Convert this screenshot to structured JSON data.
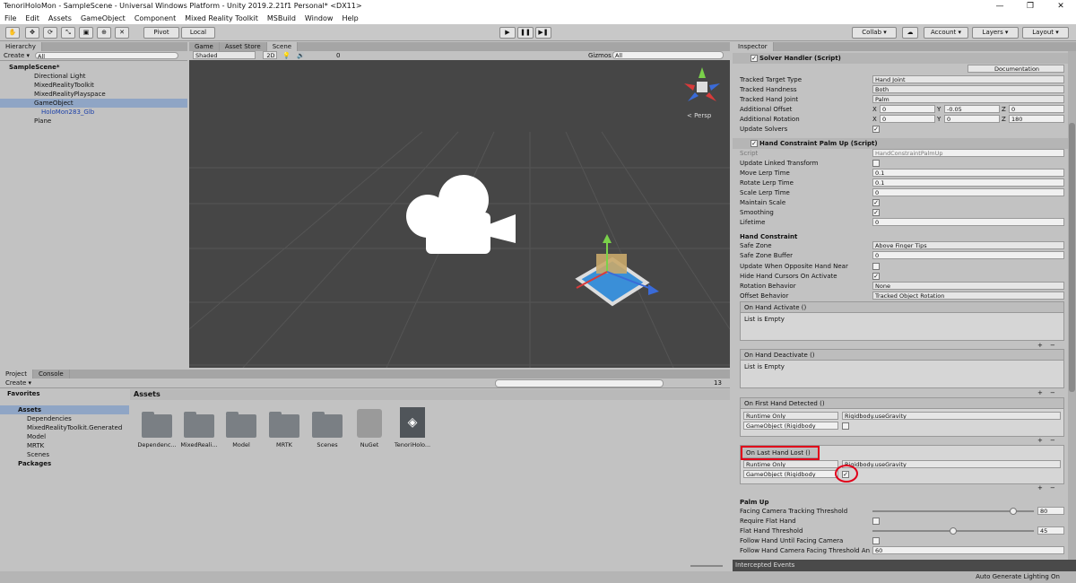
{
  "window": {
    "title": "TenoriHoloMon - SampleScene - Universal Windows Platform - Unity 2019.2.21f1 Personal* <DX11>",
    "min": "—",
    "max": "❐",
    "close": "✕"
  },
  "menu": [
    "File",
    "Edit",
    "Assets",
    "GameObject",
    "Component",
    "Mixed Reality Toolkit",
    "MSBuild",
    "Window",
    "Help"
  ],
  "toolbar": {
    "pivot": "Pivot",
    "local": "Local",
    "collab": "Collab ▾",
    "account": "Account ▾",
    "layers": "Layers ▾",
    "layout": "Layout ▾",
    "tools": [
      "✋",
      "✥",
      "⟳",
      "⤡",
      "▣",
      "⊕",
      "✕"
    ],
    "play": "▶",
    "pause": "❚❚",
    "step": "▶❚"
  },
  "hierarchy": {
    "tab": "Hierarchy",
    "create": "Create ▾",
    "search": "All",
    "items": [
      {
        "label": "SampleScene*"
      },
      {
        "label": "Directional Light"
      },
      {
        "label": "MixedRealityToolkit"
      },
      {
        "label": "MixedRealityPlayspace"
      },
      {
        "label": "GameObject"
      },
      {
        "label": "HoloMon283_Glb"
      },
      {
        "label": "Plane"
      }
    ]
  },
  "scene": {
    "tabs": [
      "Game",
      "Asset Store",
      "Scene"
    ],
    "shading": "Shaded",
    "mode2d": "2D",
    "gizmos": "Gizmos ▾",
    "search": "All",
    "persp": "< Persp",
    "counter": "0"
  },
  "project": {
    "tabs": [
      "Project",
      "Console"
    ],
    "create": "Create ▾",
    "favorites": "Favorites",
    "assets_root": "Assets",
    "tree": [
      "Dependencies",
      "MixedRealityToolkit.Generated",
      "Model",
      "MRTK",
      "Scenes"
    ],
    "packages": "Packages",
    "breadcrumb": "Assets",
    "count": "13",
    "items": [
      "Dependenc...",
      "MixedReali...",
      "Model",
      "MRTK",
      "Scenes",
      "NuGet",
      "TenoriHolo..."
    ]
  },
  "inspector": {
    "tab": "Inspector",
    "solver": {
      "title": "Solver Handler (Script)",
      "doc": "Documentation",
      "rows": [
        {
          "label": "Tracked Target Type",
          "value": "Hand Joint"
        },
        {
          "label": "Tracked Handness",
          "value": "Both"
        },
        {
          "label": "Tracked Hand Joint",
          "value": "Palm"
        }
      ],
      "offset_label": "Additional Offset",
      "offset": [
        "0",
        "-0.05",
        "0"
      ],
      "rotation_label": "Additional Rotation",
      "rotation": [
        "0",
        "0",
        "180"
      ],
      "axes": [
        "X",
        "Y",
        "Z"
      ],
      "update_label": "Update Solvers"
    },
    "palm": {
      "title": "Hand Constraint Palm Up (Script)",
      "script_label": "Script",
      "script_value": "HandConstraintPalmUp",
      "rows": [
        {
          "label": "Update Linked Transform"
        },
        {
          "label": "Move Lerp Time",
          "value": "0.1"
        },
        {
          "label": "Rotate Lerp Time",
          "value": "0.1"
        },
        {
          "label": "Scale Lerp Time",
          "value": "0"
        },
        {
          "label": "Maintain Scale"
        },
        {
          "label": "Smoothing"
        },
        {
          "label": "Lifetime",
          "value": "0"
        }
      ],
      "hc_header": "Hand Constraint",
      "hc_rows": [
        {
          "label": "Safe Zone",
          "value": "Above Finger Tips"
        },
        {
          "label": "Safe Zone Buffer",
          "value": "0"
        },
        {
          "label": "Update When Opposite Hand Near"
        },
        {
          "label": "Hide Hand Cursors On Activate"
        },
        {
          "label": "Rotation Behavior",
          "value": "None"
        },
        {
          "label": "Offset Behavior",
          "value": "Tracked Object Rotation"
        }
      ],
      "events": [
        {
          "title": "On Hand Activate ()",
          "empty": "List is Empty"
        },
        {
          "title": "On Hand Deactivate ()",
          "empty": "List is Empty"
        },
        {
          "title": "On First Hand Detected ()",
          "runtime": "Runtime Only",
          "func": "Rigidbody.useGravity",
          "obj": "GameObject (Rigidbody"
        },
        {
          "title": "On Last Hand Lost ()",
          "runtime": "Runtime Only",
          "func": "Rigidbody.useGravity",
          "obj": "GameObject (Rigidbody"
        }
      ],
      "palm_header": "Palm Up",
      "palm_rows": [
        {
          "label": "Facing Camera Tracking Threshold",
          "value": "80",
          "slider": 0.89
        },
        {
          "label": "Require Flat Hand"
        },
        {
          "label": "Flat Hand Threshold",
          "value": "45",
          "slider": 0.5
        },
        {
          "label": "Follow Hand Until Facing Camera"
        },
        {
          "label": "Follow Hand Camera Facing Threshold An",
          "value": "60"
        }
      ],
      "plus": "+",
      "minus": "−"
    },
    "intercepted": "Intercepted Events"
  },
  "status": {
    "right": "Auto Generate Lighting On"
  },
  "colors": {
    "highlight": "#e0001a",
    "scene_bg": "#464646",
    "selection": "#8fa5c5"
  }
}
